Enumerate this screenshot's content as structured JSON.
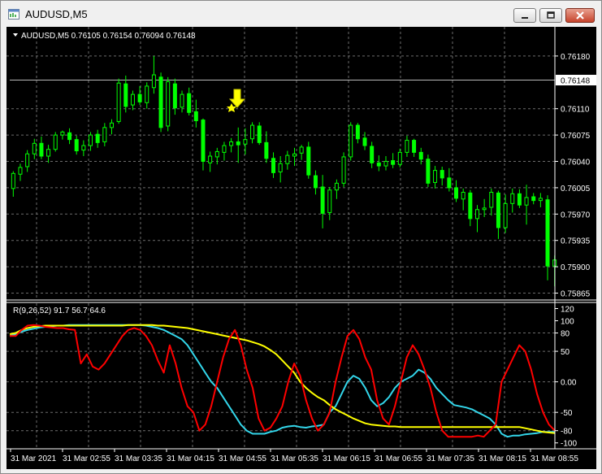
{
  "window": {
    "title": "AUDUSD,M5"
  },
  "main_panel": {
    "header": "AUDUSD,M5  0.76105 0.76154 0.76094 0.76148",
    "price_ticks": [
      "0.76180",
      "0.76110",
      "0.76075",
      "0.76040",
      "0.76005",
      "0.75970",
      "0.75935",
      "0.75900",
      "0.75865"
    ],
    "current_price": "0.76148",
    "current_price_value": 0.76148
  },
  "indicator_panel": {
    "header": "R(9,26,52) 91.7 56.7 64.6",
    "level_ticks": [
      "120",
      "100",
      "80",
      "50",
      "0.00",
      "-50",
      "-80",
      "-100"
    ]
  },
  "time_axis": {
    "labels": [
      "31 Mar 2021",
      "31 Mar 02:55",
      "31 Mar 03:35",
      "31 Mar 04:15",
      "31 Mar 04:55",
      "31 Mar 05:35",
      "31 Mar 06:15",
      "31 Mar 06:55",
      "31 Mar 07:35",
      "31 Mar 08:15",
      "31 Mar 08:55"
    ]
  },
  "colors": {
    "background": "#000000",
    "grid": "#6c6c6c",
    "candles": "#00ff00",
    "text": "#ffffff",
    "rsi_fast": "#ff0000",
    "rsi_mid": "#33d6ea",
    "rsi_slow": "#ffff00",
    "signal_arrow": "#ffff00"
  },
  "chart_data": {
    "type": "candlestick",
    "symbol": "AUDUSD",
    "timeframe": "M5",
    "ylim": [
      0.75858,
      0.76195
    ],
    "candles": [
      [
        0.76004,
        0.76027,
        0.75993,
        0.76024
      ],
      [
        0.76023,
        0.76037,
        0.76014,
        0.76032
      ],
      [
        0.76033,
        0.76055,
        0.76026,
        0.7605
      ],
      [
        0.7605,
        0.7607,
        0.76043,
        0.76064
      ],
      [
        0.76064,
        0.76073,
        0.76043,
        0.76047
      ],
      [
        0.76047,
        0.76062,
        0.76038,
        0.76056
      ],
      [
        0.76056,
        0.76079,
        0.76053,
        0.76075
      ],
      [
        0.76075,
        0.76081,
        0.76069,
        0.76079
      ],
      [
        0.76078,
        0.76084,
        0.76063,
        0.76069
      ],
      [
        0.76069,
        0.76074,
        0.76049,
        0.76054
      ],
      [
        0.76055,
        0.76068,
        0.76047,
        0.76061
      ],
      [
        0.76061,
        0.76079,
        0.76054,
        0.76075
      ],
      [
        0.76076,
        0.76082,
        0.76058,
        0.76065
      ],
      [
        0.76066,
        0.76091,
        0.7606,
        0.76085
      ],
      [
        0.76085,
        0.76096,
        0.76076,
        0.76091
      ],
      [
        0.76093,
        0.7615,
        0.7609,
        0.76144
      ],
      [
        0.76143,
        0.76154,
        0.76105,
        0.76113
      ],
      [
        0.76115,
        0.76134,
        0.76108,
        0.76129
      ],
      [
        0.76129,
        0.7614,
        0.76115,
        0.76119
      ],
      [
        0.76118,
        0.76145,
        0.7611,
        0.7614
      ],
      [
        0.76138,
        0.7618,
        0.7613,
        0.76155
      ],
      [
        0.76152,
        0.76158,
        0.76079,
        0.76085
      ],
      [
        0.76087,
        0.76152,
        0.7608,
        0.76146
      ],
      [
        0.76143,
        0.7615,
        0.76102,
        0.76111
      ],
      [
        0.76112,
        0.76134,
        0.76105,
        0.76129
      ],
      [
        0.7613,
        0.76138,
        0.76101,
        0.76105
      ],
      [
        0.76106,
        0.76122,
        0.76085,
        0.76094
      ],
      [
        0.76095,
        0.76097,
        0.76028,
        0.7604
      ],
      [
        0.76038,
        0.76053,
        0.76026,
        0.76047
      ],
      [
        0.76046,
        0.76058,
        0.76036,
        0.76053
      ],
      [
        0.76052,
        0.76066,
        0.76041,
        0.76061
      ],
      [
        0.76061,
        0.76071,
        0.76052,
        0.76066
      ],
      [
        0.76066,
        0.76085,
        0.76038,
        0.76062
      ],
      [
        0.76063,
        0.76084,
        0.76049,
        0.76069
      ],
      [
        0.7607,
        0.76092,
        0.76064,
        0.76088
      ],
      [
        0.76087,
        0.76092,
        0.76062,
        0.76065
      ],
      [
        0.76065,
        0.7608,
        0.76038,
        0.76044
      ],
      [
        0.76044,
        0.76052,
        0.76018,
        0.76025
      ],
      [
        0.76026,
        0.76047,
        0.76012,
        0.76037
      ],
      [
        0.76037,
        0.76054,
        0.76029,
        0.76048
      ],
      [
        0.76047,
        0.76058,
        0.76034,
        0.7605
      ],
      [
        0.76051,
        0.76062,
        0.76042,
        0.76059
      ],
      [
        0.76059,
        0.76066,
        0.76017,
        0.76022
      ],
      [
        0.76021,
        0.76028,
        0.75996,
        0.76005
      ],
      [
        0.76006,
        0.76022,
        0.75951,
        0.75971
      ],
      [
        0.75972,
        0.76006,
        0.75962,
        0.76002
      ],
      [
        0.76002,
        0.76016,
        0.7599,
        0.76011
      ],
      [
        0.76011,
        0.76052,
        0.76006,
        0.76046
      ],
      [
        0.76046,
        0.76092,
        0.76041,
        0.76088
      ],
      [
        0.76088,
        0.76091,
        0.76064,
        0.7607
      ],
      [
        0.76071,
        0.76079,
        0.76055,
        0.76061
      ],
      [
        0.7606,
        0.76066,
        0.76031,
        0.76038
      ],
      [
        0.76038,
        0.76048,
        0.76027,
        0.76034
      ],
      [
        0.76034,
        0.76047,
        0.76028,
        0.7604
      ],
      [
        0.76041,
        0.76051,
        0.76031,
        0.76036
      ],
      [
        0.76036,
        0.76057,
        0.76032,
        0.76052
      ],
      [
        0.76052,
        0.76074,
        0.76046,
        0.76068
      ],
      [
        0.76068,
        0.7607,
        0.76046,
        0.76052
      ],
      [
        0.76052,
        0.76058,
        0.76036,
        0.76043
      ],
      [
        0.76043,
        0.76049,
        0.76006,
        0.76011
      ],
      [
        0.76012,
        0.76034,
        0.76004,
        0.76028
      ],
      [
        0.76028,
        0.76033,
        0.76008,
        0.76018
      ],
      [
        0.76018,
        0.76031,
        0.76,
        0.76005
      ],
      [
        0.76005,
        0.76015,
        0.75986,
        0.75991
      ],
      [
        0.7599,
        0.76004,
        0.75975,
        0.75999
      ],
      [
        0.75998,
        0.76002,
        0.75954,
        0.75964
      ],
      [
        0.75964,
        0.75982,
        0.75946,
        0.75976
      ],
      [
        0.75976,
        0.7599,
        0.75966,
        0.75978
      ],
      [
        0.75979,
        0.76004,
        0.75968,
        0.75999
      ],
      [
        0.75998,
        0.76001,
        0.75937,
        0.75952
      ],
      [
        0.75952,
        0.75996,
        0.75945,
        0.75984
      ],
      [
        0.75984,
        0.76004,
        0.75972,
        0.75997
      ],
      [
        0.75997,
        0.76003,
        0.75978,
        0.75982
      ],
      [
        0.75982,
        0.76009,
        0.75956,
        0.75992
      ],
      [
        0.75993,
        0.75998,
        0.75983,
        0.75988
      ],
      [
        0.75988,
        0.75998,
        0.75979,
        0.75991
      ],
      [
        0.75989,
        0.75995,
        0.75882,
        0.75901
      ],
      [
        0.75901,
        0.75915,
        0.75874,
        0.75909
      ]
    ]
  },
  "rsi_chart": {
    "type": "line",
    "ylim": [
      -107,
      122
    ],
    "series": [
      {
        "values": [
          75,
          75,
          85,
          92,
          93,
          92,
          90,
          89,
          88,
          88,
          86,
          85,
          30,
          45,
          25,
          20,
          30,
          45,
          60,
          75,
          85,
          88,
          85,
          75,
          60,
          35,
          15,
          60,
          30,
          -10,
          -40,
          -50,
          -80,
          -70,
          -40,
          0,
          40,
          70,
          85,
          60,
          20,
          -10,
          -60,
          -80,
          -75,
          -60,
          -40,
          0,
          30,
          10,
          -30,
          -60,
          -80,
          -70,
          -50,
          0,
          40,
          75,
          85,
          70,
          40,
          20,
          -30,
          -60,
          -70,
          -40,
          0,
          40,
          60,
          45,
          20,
          -10,
          -50,
          -80,
          -90,
          -90,
          -90,
          -90,
          -90,
          -88,
          -90,
          -80,
          -70,
          0,
          20,
          40,
          60,
          50,
          20,
          -20,
          -50,
          -70,
          -80
        ]
      },
      {
        "values": [
          75,
          78,
          82,
          85,
          87,
          89,
          90,
          91,
          92,
          92,
          93,
          93,
          93,
          93,
          93,
          93,
          93,
          93,
          93,
          93,
          93,
          93,
          93,
          92,
          90,
          88,
          85,
          80,
          75,
          70,
          60,
          45,
          30,
          15,
          0,
          -10,
          -25,
          -40,
          -55,
          -70,
          -80,
          -85,
          -85,
          -85,
          -82,
          -80,
          -75,
          -73,
          -72,
          -74,
          -75,
          -73,
          -72,
          -70,
          -50,
          -40,
          -20,
          0,
          10,
          5,
          -10,
          -30,
          -40,
          -35,
          -25,
          -10,
          0,
          5,
          10,
          20,
          15,
          5,
          -10,
          -20,
          -30,
          -38,
          -40,
          -42,
          -45,
          -50,
          -55,
          -60,
          -70,
          -85,
          -90,
          -88,
          -88,
          -86,
          -85,
          -84,
          -82,
          -82,
          -82
        ]
      },
      {
        "values": [
          78,
          80,
          85,
          88,
          90,
          91,
          92,
          92,
          92,
          92,
          92,
          92,
          92,
          92,
          92,
          92,
          92,
          92,
          92,
          92,
          93,
          93,
          93,
          93,
          93,
          92,
          92,
          91,
          90,
          89,
          88,
          86,
          84,
          82,
          80,
          78,
          76,
          74,
          72,
          70,
          68,
          65,
          62,
          58,
          52,
          45,
          35,
          25,
          15,
          0,
          -10,
          -18,
          -25,
          -30,
          -38,
          -45,
          -50,
          -55,
          -60,
          -64,
          -68,
          -70,
          -71,
          -72,
          -73,
          -73,
          -74,
          -74,
          -74,
          -74,
          -74,
          -74,
          -74,
          -74,
          -74,
          -74,
          -74,
          -74,
          -74,
          -74,
          -74,
          -74,
          -74,
          -74,
          -74,
          -74,
          -74,
          -76,
          -78,
          -80,
          -82,
          -83,
          -84
        ]
      }
    ]
  }
}
